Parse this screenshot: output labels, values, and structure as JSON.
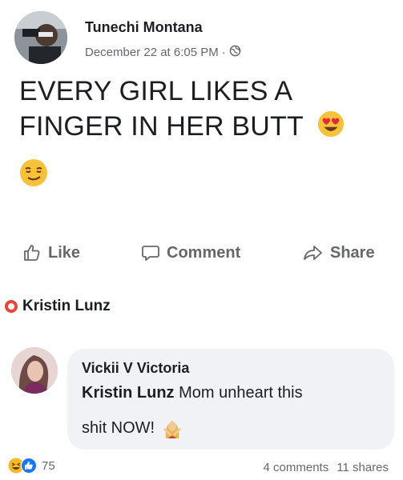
{
  "post": {
    "author": "Tunechi Montana",
    "timestamp": "December 22 at 6:05 PM",
    "separator": "·",
    "privacy_icon": "globe-icon",
    "text_line_1": "EVERY GIRL LIKES A",
    "text_line_2": "FINGER IN HER BUTT",
    "emoji_inline": "heart-eyes-emoji",
    "emoji_below": "smirk-emoji"
  },
  "actions": {
    "like_label": "Like",
    "comment_label": "Comment",
    "share_label": "Share"
  },
  "mention": {
    "name": "Kristin Lunz"
  },
  "comment": {
    "author": "Vickii V Victoria",
    "tag": "Kristin Lunz",
    "text_part_1": " Mom unheart this",
    "text_part_2": "shit NOW!",
    "emoji": "woman-gesturing-no-emoji"
  },
  "footer": {
    "reaction_count": "75",
    "comments": "4 comments",
    "shares": "11 shares"
  },
  "colors": {
    "text": "#1c1e21",
    "muted": "#65676b",
    "bubble": "#f0f2f5",
    "like_blue": "#1877f2",
    "haha_yellow": "#f7b928"
  }
}
